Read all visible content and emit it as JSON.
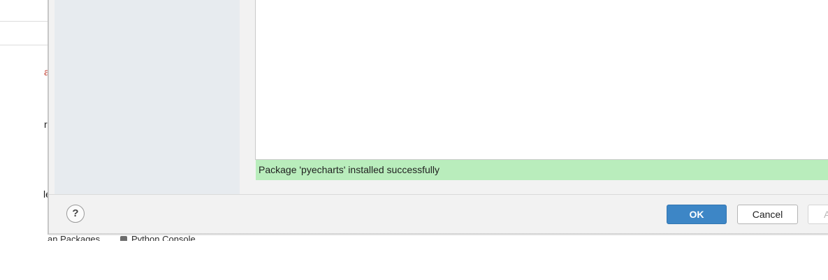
{
  "ide": {
    "fragments": [
      "a",
      "r",
      "le"
    ],
    "tool_windows": [
      "an Packages",
      "Python Console"
    ]
  },
  "dialog": {
    "status_message": "Package 'pyecharts' installed successfully",
    "help_label": "?",
    "buttons": {
      "ok": "OK",
      "cancel": "Cancel",
      "apply": "A"
    }
  },
  "colors": {
    "status_bg": "#b9edbc",
    "ok_button": "#3d86c6",
    "error_text": "#c0392b"
  },
  "icons": [
    "help-icon",
    "python-console-icon"
  ]
}
